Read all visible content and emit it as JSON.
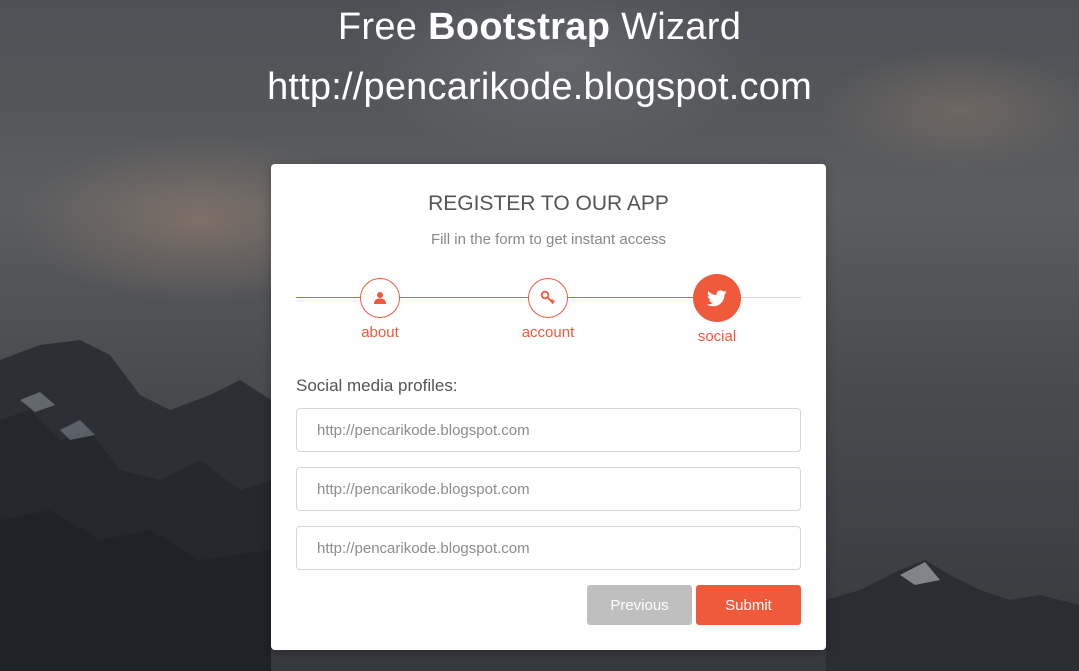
{
  "header": {
    "title_prefix": "Free ",
    "title_bold": "Bootstrap",
    "title_suffix": " Wizard",
    "url": "http://pencarikode.blogspot.com"
  },
  "card": {
    "title": "REGISTER TO OUR APP",
    "subtitle": "Fill in the form to get instant access"
  },
  "steps": [
    {
      "label": "about",
      "icon": "user-icon",
      "state": "done"
    },
    {
      "label": "account",
      "icon": "key-icon",
      "state": "done"
    },
    {
      "label": "social",
      "icon": "twitter-icon",
      "state": "active"
    }
  ],
  "form": {
    "section_label": "Social media profiles:",
    "fields": [
      {
        "placeholder": "http://pencarikode.blogspot.com",
        "value": ""
      },
      {
        "placeholder": "http://pencarikode.blogspot.com",
        "value": ""
      },
      {
        "placeholder": "http://pencarikode.blogspot.com",
        "value": ""
      }
    ]
  },
  "buttons": {
    "previous": "Previous",
    "submit": "Submit"
  },
  "colors": {
    "accent": "#f05a3c",
    "muted_button": "#bfbfbf"
  }
}
